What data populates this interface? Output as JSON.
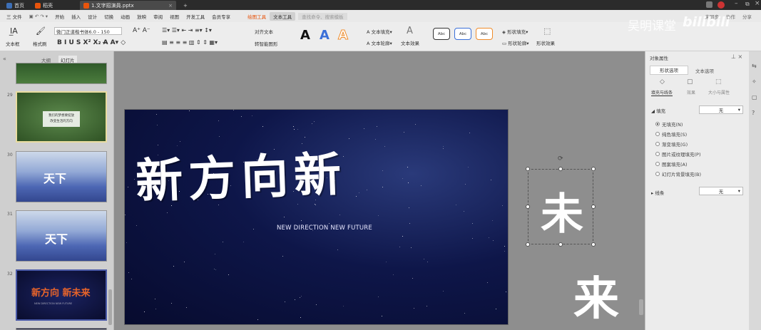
{
  "titlebar": {
    "tabs": [
      {
        "label": "首页",
        "color": "#3d6fb6"
      },
      {
        "label": "稻壳",
        "color": "#e8540c"
      },
      {
        "label": "1.文字招演員.pptx",
        "color": "#e8540c"
      }
    ]
  },
  "menubar": {
    "file": "三 文件",
    "items": [
      "开始",
      "插入",
      "设计",
      "切换",
      "动画",
      "放映",
      "审阅",
      "视图",
      "开发工具",
      "会员专享"
    ],
    "highlight": "绘图工具",
    "selected": "文本工具",
    "search": "查找命令、搜索模板",
    "right": [
      "未同步",
      "协作",
      "分享"
    ]
  },
  "ribbon": {
    "textbox": "文本框",
    "format_painter": "格式刷",
    "font": "微门正道楷书体6.0",
    "size": "150",
    "align_text": "对齐文本",
    "smart_shape": "转智能图形",
    "text_fill": "文本填充",
    "text_outline": "文本轮廓",
    "text_effect": "文本效果",
    "shape_fill": "形状填充",
    "shape_outline": "形状轮廓",
    "shape_effect": "形状效果",
    "style_samples": [
      "Abc",
      "Abc",
      "Abc"
    ]
  },
  "leftpanel": {
    "tabs": [
      "大纲",
      "幻灯片"
    ],
    "slides": [
      {
        "num": "29",
        "caption_line1": "我们的梦想要绽放",
        "caption_line2": "改变生活的方向"
      },
      {
        "num": "30",
        "caption": "天下"
      },
      {
        "num": "31",
        "caption": "天下"
      },
      {
        "num": "32",
        "caption": "新方向 新未来",
        "sub": "NEW DIRECTION NEW FUTURE"
      }
    ]
  },
  "slide": {
    "title": "新方向新",
    "subtitle": "NEW DIRECTION NEW FUTURE"
  },
  "canvas_chars": {
    "selected": "未",
    "other": "来"
  },
  "rightpanel": {
    "title": "对象属性",
    "tabs": [
      "形状选项",
      "文本选项"
    ],
    "subtabs": [
      "填充与线条",
      "效果",
      "大小与属性"
    ],
    "fill_label": "填充",
    "fill_value": "无",
    "options": [
      "无填充(N)",
      "纯色填充(S)",
      "渐变填充(G)",
      "图片或纹理填充(P)",
      "图案填充(A)",
      "幻灯片背景填充(B)"
    ],
    "line_label": "线条",
    "line_value": "无"
  },
  "watermark": {
    "text": "吴明课堂",
    "brand": "bilibili"
  }
}
